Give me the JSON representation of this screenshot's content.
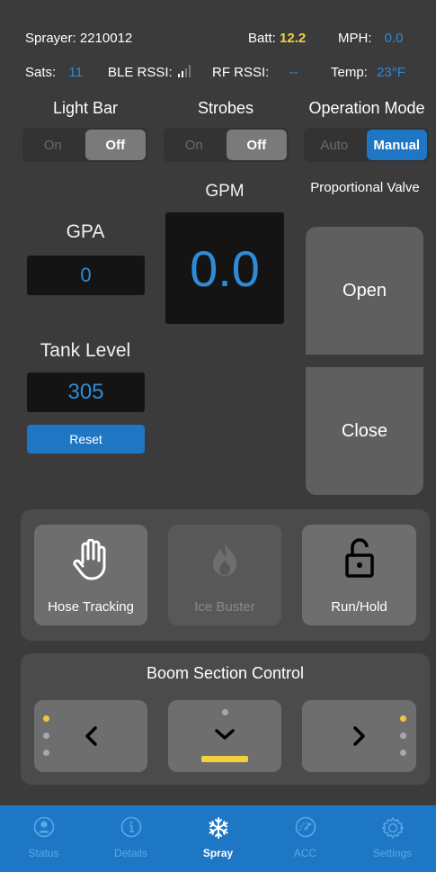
{
  "status": {
    "sprayer_label": "Sprayer:",
    "sprayer_id": "2210012",
    "batt_label": "Batt:",
    "batt_value": "12.2",
    "mph_label": "MPH:",
    "mph_value": "0.0",
    "sats_label": "Sats:",
    "sats_value": "11",
    "ble_label": "BLE RSSI:",
    "rf_label": "RF RSSI:",
    "rf_value": "--",
    "temp_label": "Temp:",
    "temp_value": "23°F"
  },
  "toggles": {
    "light_bar": {
      "title": "Light Bar",
      "on": "On",
      "off": "Off",
      "selected": "Off"
    },
    "strobes": {
      "title": "Strobes",
      "on": "On",
      "off": "Off",
      "selected": "Off"
    },
    "operation_mode": {
      "title": "Operation Mode",
      "auto": "Auto",
      "manual": "Manual",
      "selected": "Manual"
    }
  },
  "gpa": {
    "label": "GPA",
    "value": "0"
  },
  "gpm": {
    "label": "GPM",
    "value": "0.0"
  },
  "tank": {
    "label": "Tank Level",
    "value": "305",
    "reset_label": "Reset"
  },
  "valve": {
    "label": "Proportional Valve",
    "open_label": "Open",
    "close_label": "Close"
  },
  "actions": {
    "hose_tracking": "Hose Tracking",
    "ice_buster": "Ice Buster",
    "run_hold": "Run/Hold"
  },
  "boom": {
    "title": "Boom Section Control"
  },
  "tabs": [
    {
      "label": "Status",
      "icon": "person-icon"
    },
    {
      "label": "Details",
      "icon": "info-icon"
    },
    {
      "label": "Spray",
      "icon": "snowflake-icon"
    },
    {
      "label": "ACC",
      "icon": "gauge-icon"
    },
    {
      "label": "Settings",
      "icon": "gear-icon"
    }
  ],
  "colors": {
    "accent_blue": "#1f76c2",
    "value_blue": "#2e8bd8",
    "batt_yellow": "#f2d23a",
    "indicator_yellow": "#f2c63a"
  }
}
